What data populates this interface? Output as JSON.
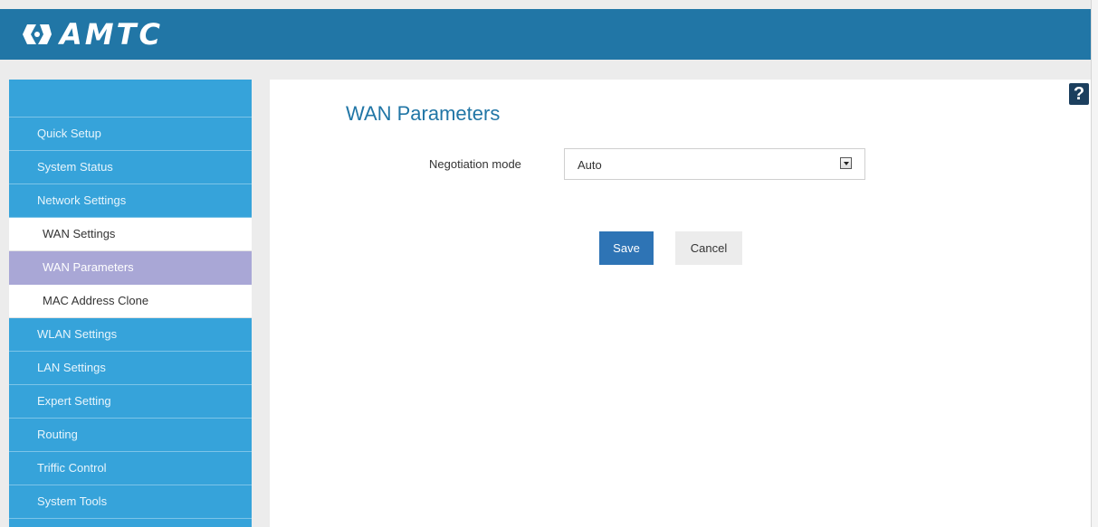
{
  "colors": {
    "header": "#2176a6",
    "sidebar": "#36a3da",
    "active_item": "#a9a7d6",
    "title": "#2176a6",
    "save_button": "#2e74b5"
  },
  "header": {
    "logo_text": "AMTC",
    "logo_icon": "amtc-logo-icon"
  },
  "sidebar": {
    "items": [
      {
        "label": "Quick Setup"
      },
      {
        "label": "System Status"
      },
      {
        "label": "Network Settings"
      },
      {
        "label": "WAN Settings"
      },
      {
        "label": "WAN Parameters",
        "active": true
      },
      {
        "label": "MAC Address Clone"
      },
      {
        "label": "WLAN Settings"
      },
      {
        "label": "LAN Settings"
      },
      {
        "label": "Expert Setting"
      },
      {
        "label": "Routing"
      },
      {
        "label": "Triffic Control"
      },
      {
        "label": "System Tools"
      }
    ]
  },
  "main": {
    "title": "WAN Parameters",
    "help_label": "?",
    "negotiation": {
      "label": "Negotiation mode",
      "value": "Auto"
    },
    "save_label": "Save",
    "cancel_label": "Cancel"
  }
}
